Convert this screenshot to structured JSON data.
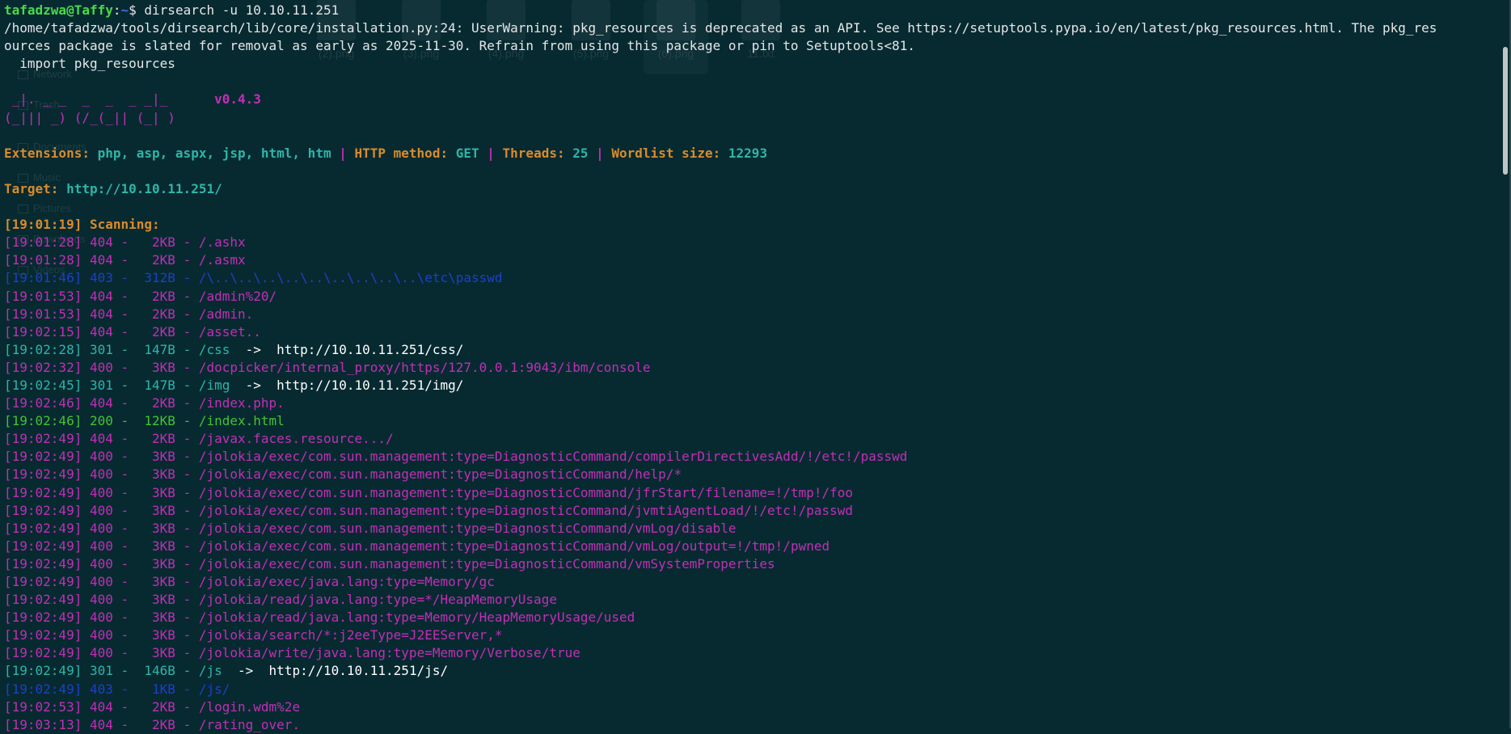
{
  "desktop": {
    "sidebar": [
      "Network",
      "Trash",
      "Documents",
      "Music",
      "Pictures",
      "Downloads",
      "Videos"
    ],
    "files": [
      "(2).png",
      "(3).png",
      "(4).png",
      "(5).png",
      "(6).png",
      "11.txt"
    ]
  },
  "terminal": {
    "prompt_user": "tafadzwa@Taffy",
    "prompt_sep": ":",
    "prompt_path": "~",
    "prompt_symbol": "$ ",
    "command": "dirsearch -u 10.10.11.251",
    "warning_line1": "/home/tafadzwa/tools/dirsearch/lib/core/installation.py:24: UserWarning: pkg_resources is deprecated as an API. See https://setuptools.pypa.io/en/latest/pkg_resources.html. The pkg_res",
    "warning_line2": "ources package is slated for removal as early as 2025-11-30. Refrain from using this package or pin to Setuptools<81.",
    "warning_line3": "  import pkg_resources",
    "logo_line1": " _|. _ _  _  _  _ _|_",
    "logo_version": "v0.4.3",
    "logo_line2": "(_||| _) (/_(_|| (_| )",
    "config": {
      "ext_label": "Extensions: ",
      "ext_value": "php, asp, aspx, jsp, html, htm",
      "sep": " | ",
      "method_label": "HTTP method: ",
      "method_value": "GET",
      "threads_label": "Threads: ",
      "threads_value": "25",
      "wordlist_label": "Wordlist size: ",
      "wordlist_value": "12293"
    },
    "target_label": "Target: ",
    "target_value": "http://10.10.11.251/",
    "scan_time": "[19:01:19]",
    "scan_label": " Scanning:",
    "results": [
      {
        "time": "[19:01:28]",
        "status": "404",
        "size": "2KB",
        "path": "/.ashx",
        "redirect": "",
        "color": "magenta"
      },
      {
        "time": "[19:01:28]",
        "status": "404",
        "size": "2KB",
        "path": "/.asmx",
        "redirect": "",
        "color": "magenta"
      },
      {
        "time": "[19:01:46]",
        "status": "403",
        "size": "312B",
        "path": "/\\..\\..\\..\\..\\..\\..\\..\\..\\..\\etc\\passwd",
        "redirect": "",
        "color": "blue"
      },
      {
        "time": "[19:01:53]",
        "status": "404",
        "size": "2KB",
        "path": "/admin%20/",
        "redirect": "",
        "color": "magenta"
      },
      {
        "time": "[19:01:53]",
        "status": "404",
        "size": "2KB",
        "path": "/admin.",
        "redirect": "",
        "color": "magenta"
      },
      {
        "time": "[19:02:15]",
        "status": "404",
        "size": "2KB",
        "path": "/asset..",
        "redirect": "",
        "color": "magenta"
      },
      {
        "time": "[19:02:28]",
        "status": "301",
        "size": "147B",
        "path": "/css",
        "redirect": "http://10.10.11.251/css/",
        "color": "teal"
      },
      {
        "time": "[19:02:32]",
        "status": "400",
        "size": "3KB",
        "path": "/docpicker/internal_proxy/https/127.0.0.1:9043/ibm/console",
        "redirect": "",
        "color": "magenta"
      },
      {
        "time": "[19:02:45]",
        "status": "301",
        "size": "147B",
        "path": "/img",
        "redirect": "http://10.10.11.251/img/",
        "color": "teal"
      },
      {
        "time": "[19:02:46]",
        "status": "404",
        "size": "2KB",
        "path": "/index.php.",
        "redirect": "",
        "color": "magenta"
      },
      {
        "time": "[19:02:46]",
        "status": "200",
        "size": "12KB",
        "path": "/index.html",
        "redirect": "",
        "color": "green"
      },
      {
        "time": "[19:02:49]",
        "status": "404",
        "size": "2KB",
        "path": "/javax.faces.resource.../",
        "redirect": "",
        "color": "magenta"
      },
      {
        "time": "[19:02:49]",
        "status": "400",
        "size": "3KB",
        "path": "/jolokia/exec/com.sun.management:type=DiagnosticCommand/compilerDirectivesAdd/!/etc!/passwd",
        "redirect": "",
        "color": "magenta"
      },
      {
        "time": "[19:02:49]",
        "status": "400",
        "size": "3KB",
        "path": "/jolokia/exec/com.sun.management:type=DiagnosticCommand/help/*",
        "redirect": "",
        "color": "magenta"
      },
      {
        "time": "[19:02:49]",
        "status": "400",
        "size": "3KB",
        "path": "/jolokia/exec/com.sun.management:type=DiagnosticCommand/jfrStart/filename=!/tmp!/foo",
        "redirect": "",
        "color": "magenta"
      },
      {
        "time": "[19:02:49]",
        "status": "400",
        "size": "3KB",
        "path": "/jolokia/exec/com.sun.management:type=DiagnosticCommand/jvmtiAgentLoad/!/etc!/passwd",
        "redirect": "",
        "color": "magenta"
      },
      {
        "time": "[19:02:49]",
        "status": "400",
        "size": "3KB",
        "path": "/jolokia/exec/com.sun.management:type=DiagnosticCommand/vmLog/disable",
        "redirect": "",
        "color": "magenta"
      },
      {
        "time": "[19:02:49]",
        "status": "400",
        "size": "3KB",
        "path": "/jolokia/exec/com.sun.management:type=DiagnosticCommand/vmLog/output=!/tmp!/pwned",
        "redirect": "",
        "color": "magenta"
      },
      {
        "time": "[19:02:49]",
        "status": "400",
        "size": "3KB",
        "path": "/jolokia/exec/com.sun.management:type=DiagnosticCommand/vmSystemProperties",
        "redirect": "",
        "color": "magenta"
      },
      {
        "time": "[19:02:49]",
        "status": "400",
        "size": "3KB",
        "path": "/jolokia/exec/java.lang:type=Memory/gc",
        "redirect": "",
        "color": "magenta"
      },
      {
        "time": "[19:02:49]",
        "status": "400",
        "size": "3KB",
        "path": "/jolokia/read/java.lang:type=*/HeapMemoryUsage",
        "redirect": "",
        "color": "magenta"
      },
      {
        "time": "[19:02:49]",
        "status": "400",
        "size": "3KB",
        "path": "/jolokia/read/java.lang:type=Memory/HeapMemoryUsage/used",
        "redirect": "",
        "color": "magenta"
      },
      {
        "time": "[19:02:49]",
        "status": "400",
        "size": "3KB",
        "path": "/jolokia/search/*:j2eeType=J2EEServer,*",
        "redirect": "",
        "color": "magenta"
      },
      {
        "time": "[19:02:49]",
        "status": "400",
        "size": "3KB",
        "path": "/jolokia/write/java.lang:type=Memory/Verbose/true",
        "redirect": "",
        "color": "magenta"
      },
      {
        "time": "[19:02:49]",
        "status": "301",
        "size": "146B",
        "path": "/js",
        "redirect": "http://10.10.11.251/js/",
        "color": "teal"
      },
      {
        "time": "[19:02:49]",
        "status": "403",
        "size": "1KB",
        "path": "/js/",
        "redirect": "",
        "color": "blue"
      },
      {
        "time": "[19:02:53]",
        "status": "404",
        "size": "2KB",
        "path": "/login.wdm%2e",
        "redirect": "",
        "color": "magenta"
      },
      {
        "time": "[19:03:13]",
        "status": "404",
        "size": "2KB",
        "path": "/rating_over.",
        "redirect": "",
        "color": "magenta"
      }
    ]
  },
  "colors": {
    "background": "#072a31",
    "user": "#4ad94a",
    "path": "#3a6ee8",
    "orange": "#d98b2b",
    "teal": "#2fb5a8",
    "magenta": "#c12fb5",
    "green": "#45c233",
    "blue": "#1e3fc9"
  }
}
